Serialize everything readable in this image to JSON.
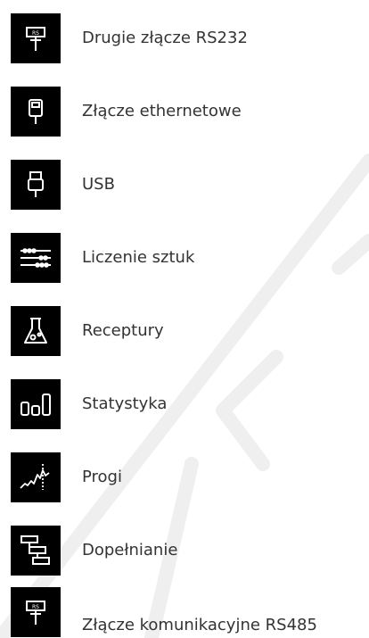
{
  "features": {
    "items": [
      {
        "label": "Drugie złącze RS232",
        "icon": "serial-connector-icon"
      },
      {
        "label": "Złącze ethernetowe",
        "icon": "ethernet-connector-icon"
      },
      {
        "label": "USB",
        "icon": "usb-icon"
      },
      {
        "label": "Liczenie sztuk",
        "icon": "counting-abacus-icon"
      },
      {
        "label": "Receptury",
        "icon": "flask-icon"
      },
      {
        "label": "Statystyka",
        "icon": "statistics-bars-icon"
      },
      {
        "label": "Progi",
        "icon": "thresholds-chart-icon"
      },
      {
        "label": "Dopełnianie",
        "icon": "dosing-flow-icon"
      },
      {
        "label": "Złącze komunikacyjne RS485",
        "icon": "serial-connector-icon"
      }
    ]
  },
  "colors": {
    "icon_tile_background": "#000000",
    "icon_stroke": "#ffffff",
    "label_text": "#333333",
    "watermark": "#f0f0f0"
  }
}
